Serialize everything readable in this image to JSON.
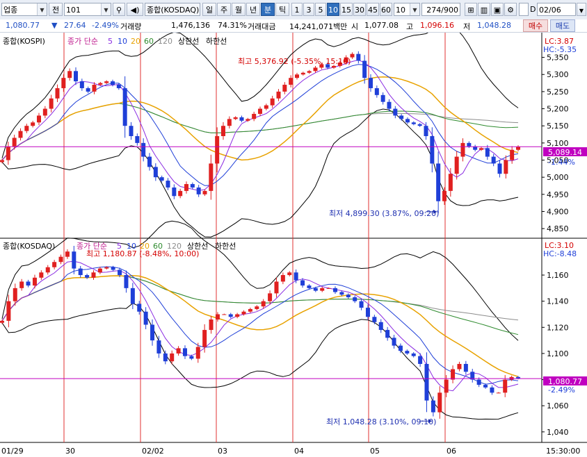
{
  "toolbar": {
    "market_type": "업종",
    "prev_label": "전",
    "code": "101",
    "index_name": "종합(KOSDAQ)",
    "periods": [
      "일",
      "주",
      "월",
      "년",
      "분",
      "틱"
    ],
    "selected_period": "분",
    "intervals": [
      "1",
      "3",
      "5",
      "10",
      "15",
      "30",
      "45",
      "60"
    ],
    "selected_interval": "10",
    "interval_input": "10",
    "count": "274/900",
    "d_label": "D",
    "date": "02/06"
  },
  "infobar": {
    "price": "1,080.77",
    "change_arrow": "▼",
    "change": "27.64",
    "change_pct": "-2.49%",
    "volume_label": "거래량",
    "volume": "1,476,136",
    "volume_pct": "74.31%",
    "amount_label": "거래대금",
    "amount": "14,241,071백만",
    "open_label": "시",
    "open": "1,077.08",
    "high_label": "고",
    "high": "1,096.16",
    "low_label": "저",
    "low": "1,048.28",
    "buy_button": "매수",
    "sell_button": "매도"
  },
  "colors": {
    "up": "#e02020",
    "down": "#1f3fd8",
    "ma5": "#8a2be2",
    "ma20": "#e8a200",
    "ma60": "#2e8b2e",
    "ma120": "#8c8c8c",
    "band": "#000000",
    "vline": "#e03030",
    "hline": "#c000c0",
    "annotation_high": "#d40000",
    "annotation_low": "#1e2fb0"
  },
  "date_labels": [
    "01/29",
    "30",
    "02/02",
    "03",
    "04",
    "05",
    "06"
  ],
  "time_label": "15:30:00",
  "top_panel": {
    "legend": {
      "name": "종합(KOSPI)",
      "ma_label": "종가 단순",
      "periods": [
        "5",
        "10",
        "20",
        "60",
        "120"
      ],
      "upper": "상한선",
      "lower": "하한선"
    },
    "lc": "LC:3.87",
    "hc": "HC:-5.35",
    "current_value": "5,089.14",
    "current_pct": "-1.44%",
    "high_annotation": "최고 5,376.92 (-5.35%, 15:10)",
    "low_annotation": "최저 4,899.30 (3.87%, 09:20)"
  },
  "bottom_panel": {
    "legend": {
      "name": "종합(KOSDAQ)",
      "ma_label": "종가 단순",
      "periods": [
        "5",
        "10",
        "20",
        "60",
        "120"
      ],
      "upper": "상한선",
      "lower": "하한선"
    },
    "lc": "LC:3.10",
    "hc": "HC:-8.48",
    "current_value": "1,080.77",
    "current_pct": "-2.49%",
    "high_annotation": "최고 1,180.87 (-8.48%, 10:00)",
    "low_annotation": "최저 1,048.28 (3.10%, 09:10)"
  },
  "chart_data": [
    {
      "type": "candlestick",
      "title": "종합(KOSPI)",
      "x": [
        "01/29",
        "30",
        "02/02",
        "03",
        "04",
        "05",
        "06"
      ],
      "ylim": [
        4830,
        5410
      ],
      "y_ticks": [
        4850,
        4900,
        4950,
        5000,
        5050,
        5100,
        5150,
        5200,
        5250,
        5300,
        5350
      ],
      "y_tick_labels": [
        "4,850",
        "4,900",
        "4,950",
        "5,000",
        "5,050",
        "5,100",
        "5,150",
        "5,200",
        "5,250",
        "5,300",
        "5,350"
      ],
      "close": [
        5050,
        5090,
        5115,
        5135,
        5150,
        5160,
        5180,
        5200,
        5230,
        5260,
        5290,
        5310,
        5280,
        5260,
        5250,
        5270,
        5275,
        5280,
        5270,
        5260,
        5150,
        5120,
        5100,
        5060,
        5030,
        5000,
        4990,
        4970,
        4945,
        4960,
        4980,
        4970,
        4950,
        4960,
        5040,
        5120,
        5150,
        5170,
        5175,
        5165,
        5170,
        5185,
        5200,
        5210,
        5230,
        5250,
        5270,
        5290,
        5300,
        5305,
        5310,
        5320,
        5330,
        5320,
        5325,
        5335,
        5350,
        5360,
        5340,
        5290,
        5260,
        5240,
        5220,
        5200,
        5180,
        5170,
        5160,
        5155,
        5150,
        5120,
        5040,
        4930,
        4960,
        5010,
        5060,
        5100,
        5090,
        5080,
        5085,
        5060,
        5040,
        5010,
        5050,
        5080,
        5089
      ],
      "hline": 5089.14,
      "annotations": [
        {
          "text": "최고 5,376.92 (-5.35%, 15:10)",
          "value": 5376.92
        },
        {
          "text": "최저 4,899.30 (3.87%, 09:20)",
          "value": 4899.3
        }
      ]
    },
    {
      "type": "candlestick",
      "title": "종합(KOSDAQ)",
      "x": [
        "01/29",
        "30",
        "02/02",
        "03",
        "04",
        "05",
        "06"
      ],
      "ylim": [
        1033,
        1185
      ],
      "y_ticks": [
        1040,
        1060,
        1080,
        1100,
        1120,
        1140,
        1160
      ],
      "y_tick_labels": [
        "1,040",
        "1,060",
        "1,080",
        "1,100",
        "1,120",
        "1,140",
        "1,160"
      ],
      "close": [
        1125,
        1140,
        1150,
        1155,
        1152,
        1158,
        1162,
        1166,
        1170,
        1174,
        1178,
        1165,
        1160,
        1158,
        1162,
        1165,
        1166,
        1164,
        1160,
        1150,
        1138,
        1132,
        1122,
        1110,
        1100,
        1094,
        1100,
        1104,
        1098,
        1096,
        1105,
        1118,
        1126,
        1130,
        1130,
        1128,
        1130,
        1132,
        1134,
        1136,
        1140,
        1146,
        1155,
        1160,
        1162,
        1156,
        1152,
        1150,
        1148,
        1150,
        1150,
        1147,
        1145,
        1143,
        1140,
        1135,
        1128,
        1124,
        1118,
        1112,
        1106,
        1102,
        1100,
        1098,
        1092,
        1064,
        1055,
        1070,
        1080,
        1088,
        1092,
        1086,
        1080,
        1076,
        1074,
        1070,
        1070,
        1080,
        1082,
        1081
      ],
      "hline": 1080.77,
      "annotations": [
        {
          "text": "최고 1,180.87 (-8.48%, 10:00)",
          "value": 1180.87
        },
        {
          "text": "최저 1,048.28 (3.10%, 09:10)",
          "value": 1048.28
        }
      ]
    }
  ]
}
